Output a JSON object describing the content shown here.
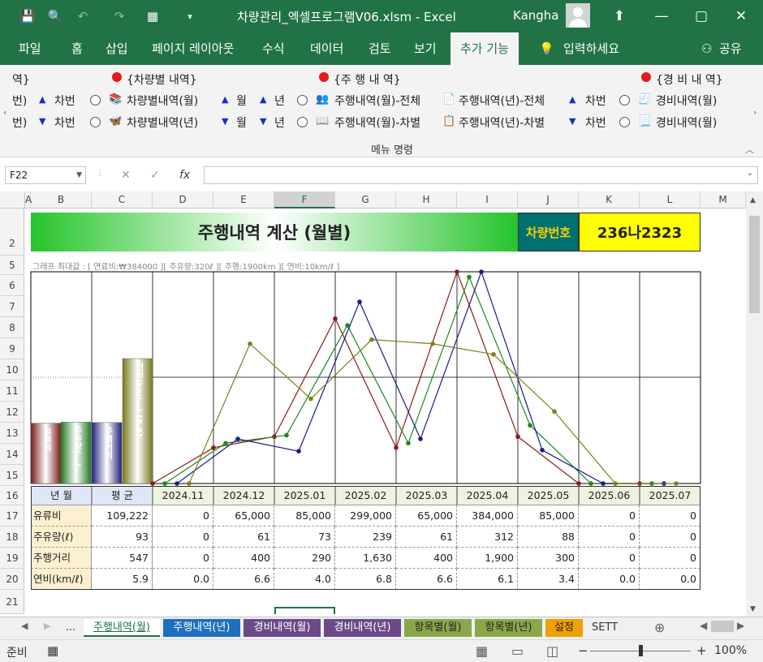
{
  "window": {
    "title": "차량관리_엑셀프로그램V06.xlsm  -  Excel",
    "user": "Kangha",
    "minimize": "—",
    "restore": "▢",
    "close": "✕",
    "ribbon_display": "⬆"
  },
  "quick_access": {
    "save": "💾",
    "preview": "🔍",
    "undo": "↶",
    "redo": "↷",
    "form": "▦",
    "more": "▾"
  },
  "menu_tabs": [
    "파일",
    "홈",
    "삽입",
    "페이지 레이아웃",
    "수식",
    "데이터",
    "검토",
    "보기",
    "추가 기능"
  ],
  "tell_me": "입력하세요",
  "share": "공유",
  "ribbon": {
    "group_label": "메뉴 명령",
    "sections": {
      "vehicle": "{차량별 내역}",
      "driving": "{주 행 내 역}",
      "expense": "{경 비 내 역}"
    },
    "cut_label": "역}",
    "row1": {
      "cut_left": "번)",
      "car_no": "차번",
      "item1": "차량별내역(월)",
      "month": "월",
      "year": "년",
      "item2": "주행내역(월)-전체",
      "item3": "주행내역(년)-전체",
      "car_no2": "차번",
      "item4": "경비내역(월)"
    },
    "row2": {
      "cut_left": "번)",
      "car_no": "차번",
      "item1": "차량별내역(년)",
      "month": "월",
      "year": "년",
      "item2": "주행내역(월)-차별",
      "item3": "주행내역(년)-차별",
      "car_no2": "차번",
      "item4": "경비내역(월)"
    }
  },
  "formula_bar": {
    "name_box": "F22",
    "fx": "fx",
    "cancel": "✕",
    "enter": "✓",
    "value": ""
  },
  "columns": [
    "A",
    "B",
    "C",
    "D",
    "E",
    "F",
    "G",
    "H",
    "I",
    "J",
    "K",
    "L",
    "M"
  ],
  "rows": [
    "2",
    "5",
    "6",
    "7",
    "8",
    "9",
    "10",
    "11",
    "12",
    "13",
    "14",
    "15",
    "16",
    "17",
    "18",
    "19",
    "20",
    "21"
  ],
  "sheet": {
    "title": "주행내역 계산 (월별)",
    "vehicle_label": "차량번호",
    "vehicle_number": "236나2323",
    "graph_note": "그래프 최대값 : [ 연료비:₩384000 ][ 주유량:320ℓ ][ 주행:1900km ][ 연비:10km/ℓ ]",
    "avg_bars": [
      {
        "label": "유류비",
        "fraction": 0.285,
        "color": "#7a1a1a"
      },
      {
        "label": "주유량(ℓ)",
        "fraction": 0.29,
        "color": "#1f7a1f"
      },
      {
        "label": "주행거리",
        "fraction": 0.288,
        "color": "#1f1f7a"
      },
      {
        "label": "연비(km/ℓ) [5.9]",
        "fraction": 0.59,
        "color": "#77771a"
      }
    ],
    "table": {
      "header": {
        "label": "년 월",
        "avg": "평 균",
        "months": [
          "2024.11",
          "2024.12",
          "2025.01",
          "2025.02",
          "2025.03",
          "2025.04",
          "2025.05",
          "2025.06",
          "2025.07"
        ]
      },
      "rows": [
        {
          "label": "유류비",
          "avg": "109,222",
          "values": [
            "0",
            "65,000",
            "85,000",
            "299,000",
            "65,000",
            "384,000",
            "85,000",
            "0",
            "0"
          ]
        },
        {
          "label": "주유량(ℓ)",
          "avg": "93",
          "values": [
            "0",
            "61",
            "73",
            "239",
            "61",
            "312",
            "88",
            "0",
            "0"
          ]
        },
        {
          "label": "주행거리",
          "avg": "547",
          "values": [
            "0",
            "400",
            "290",
            "1,630",
            "400",
            "1,900",
            "300",
            "0",
            "0"
          ]
        },
        {
          "label": "연비(km/ℓ)",
          "avg": "5.9",
          "values": [
            "0.0",
            "6.6",
            "4.0",
            "6.8",
            "6.6",
            "6.1",
            "3.4",
            "0.0",
            "0.0"
          ]
        }
      ]
    }
  },
  "chart_data": {
    "type": "line",
    "categories": [
      "2024.11",
      "2024.12",
      "2025.01",
      "2025.02",
      "2025.03",
      "2025.04",
      "2025.05",
      "2025.06",
      "2025.07"
    ],
    "series": [
      {
        "name": "유류비",
        "color": "#8b1a1a",
        "values": [
          0,
          65000,
          85000,
          299000,
          65000,
          384000,
          85000,
          0,
          0
        ],
        "max": 384000
      },
      {
        "name": "주유량(ℓ)",
        "color": "#1a8b1a",
        "values": [
          0,
          61,
          73,
          239,
          61,
          312,
          88,
          0,
          0
        ],
        "max": 320
      },
      {
        "name": "주행거리",
        "color": "#1a1a8b",
        "values": [
          0,
          400,
          290,
          1630,
          400,
          1900,
          300,
          0,
          0
        ],
        "max": 1900
      },
      {
        "name": "연비(km/ℓ)",
        "color": "#7f7f1a",
        "values": [
          0,
          6.6,
          4.0,
          6.8,
          6.6,
          6.1,
          3.4,
          0,
          0
        ],
        "max": 10
      }
    ],
    "ylim": [
      0,
      1
    ],
    "grid": true
  },
  "sheet_tabs": [
    {
      "label": "...",
      "color": ""
    },
    {
      "label": "주행내역(월)",
      "color": "active"
    },
    {
      "label": "주행내역(년)",
      "color": "#1f6fbf"
    },
    {
      "label": "경비내역(월)",
      "color": "#6b4a8a"
    },
    {
      "label": "경비내역(년)",
      "color": "#6b4a8a"
    },
    {
      "label": "항목별(월)",
      "color": "#8aa84a"
    },
    {
      "label": "항목별(년)",
      "color": "#8aa84a"
    },
    {
      "label": "설정",
      "color": "#f0a000"
    },
    {
      "label": "SETT",
      "color": ""
    }
  ],
  "status": {
    "ready": "준비",
    "zoom": "100%",
    "minus": "−",
    "plus": "+"
  }
}
